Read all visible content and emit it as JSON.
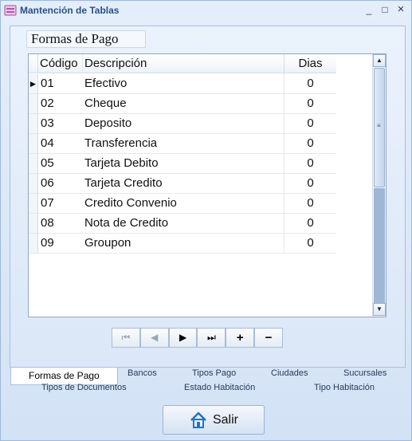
{
  "window": {
    "title": "Mantención de Tablas",
    "minimize": "_",
    "maximize": "□",
    "close": "×"
  },
  "group_title": "Formas de Pago",
  "grid": {
    "columns": [
      "Código",
      "Descripción",
      "Dias"
    ],
    "current_row_marker": "▶",
    "rows": [
      {
        "codigo": "01",
        "descripcion": "Efectivo",
        "dias": "0"
      },
      {
        "codigo": "02",
        "descripcion": "Cheque",
        "dias": "0"
      },
      {
        "codigo": "03",
        "descripcion": "Deposito",
        "dias": "0"
      },
      {
        "codigo": "04",
        "descripcion": "Transferencia",
        "dias": "0"
      },
      {
        "codigo": "05",
        "descripcion": "Tarjeta Debito",
        "dias": "0"
      },
      {
        "codigo": "06",
        "descripcion": "Tarjeta Credito",
        "dias": "0"
      },
      {
        "codigo": "07",
        "descripcion": "Credito Convenio",
        "dias": "0"
      },
      {
        "codigo": "08",
        "descripcion": "Nota de Credito",
        "dias": "0"
      },
      {
        "codigo": "09",
        "descripcion": "Groupon",
        "dias": "0"
      }
    ]
  },
  "navigator": {
    "first": "⏮",
    "prev": "◀",
    "next": "▶",
    "last": "⏭",
    "add": "+",
    "delete": "−"
  },
  "tabs": {
    "row1": [
      "Formas de Pago",
      "Bancos",
      "Tipos Pago",
      "Ciudades",
      "Sucursales"
    ],
    "row2": [
      "Tipos de Documentos",
      "Estado Habitación",
      "Tipo Habitación"
    ]
  },
  "exit_button": "Salir"
}
